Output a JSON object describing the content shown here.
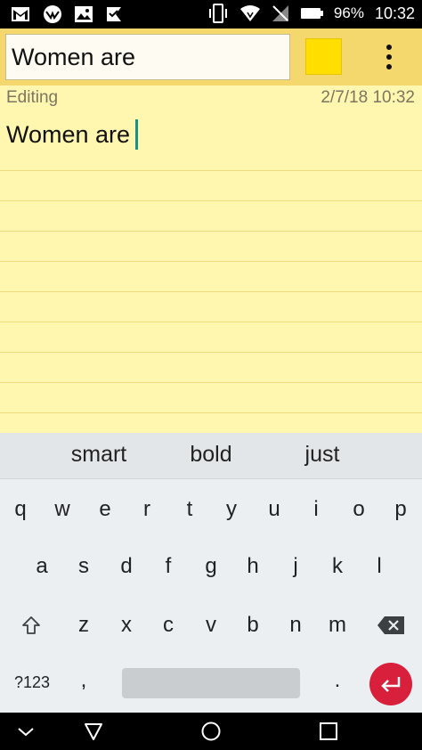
{
  "status_bar": {
    "left_icons": [
      "gmail-icon",
      "browser-icon",
      "image-icon",
      "flag-icon"
    ],
    "right_icons": [
      "vibrate-icon",
      "wifi-icon",
      "no-signal-icon",
      "battery-icon"
    ],
    "battery_percent": "96%",
    "time": "10:32"
  },
  "toolbar": {
    "title_value": "Women are",
    "note_color": "#ffde00",
    "more_icon": "more-vert-icon"
  },
  "note": {
    "status": "Editing",
    "date": "2/7/18 10:32",
    "body": "Women are"
  },
  "keyboard": {
    "suggestions": [
      "smart",
      "bold",
      "just"
    ],
    "row1": [
      "q",
      "w",
      "e",
      "r",
      "t",
      "y",
      "u",
      "i",
      "o",
      "p"
    ],
    "row2": [
      "a",
      "s",
      "d",
      "f",
      "g",
      "h",
      "j",
      "k",
      "l"
    ],
    "row3": [
      "z",
      "x",
      "c",
      "v",
      "b",
      "n",
      "m"
    ],
    "symbols_key": "?123",
    "comma_key": ",",
    "period_key": ".",
    "enter_color": "#d81f3c"
  },
  "nav_bar": {
    "buttons": [
      "hide-keyboard-icon",
      "back-icon",
      "home-icon",
      "recents-icon"
    ]
  }
}
